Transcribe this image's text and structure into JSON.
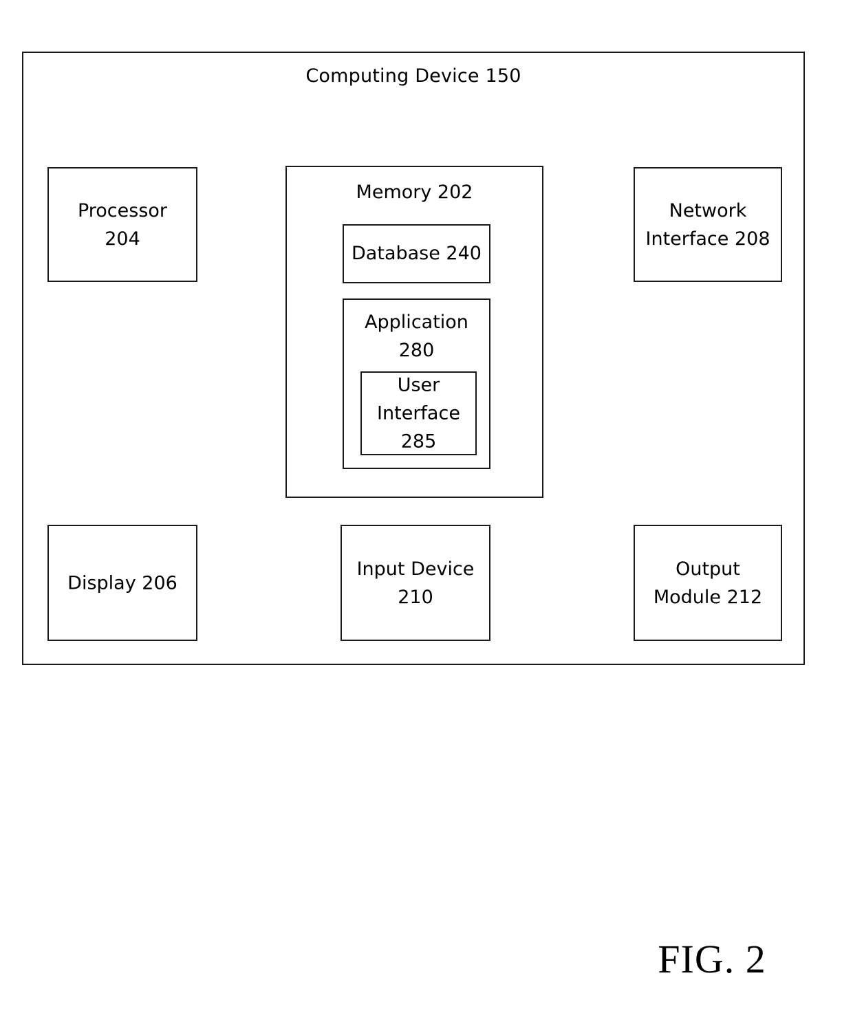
{
  "figure": {
    "caption": "FIG. 2"
  },
  "diagram": {
    "title": "Computing Device 150",
    "blocks": {
      "processor": {
        "line1": "Processor",
        "line2": "204"
      },
      "memory": {
        "title": "Memory 202",
        "database": {
          "line1": "Database 240"
        },
        "application": {
          "line1": "Application",
          "line2": "280",
          "user_interface": {
            "line1": "User",
            "line2": "Interface",
            "line3": "285"
          }
        }
      },
      "network_interface": {
        "line1": "Network",
        "line2": "Interface 208"
      },
      "display": {
        "line1": "Display 206"
      },
      "input_device": {
        "line1": "Input Device",
        "line2": "210"
      },
      "output_module": {
        "line1": "Output",
        "line2": "Module 212"
      }
    }
  }
}
